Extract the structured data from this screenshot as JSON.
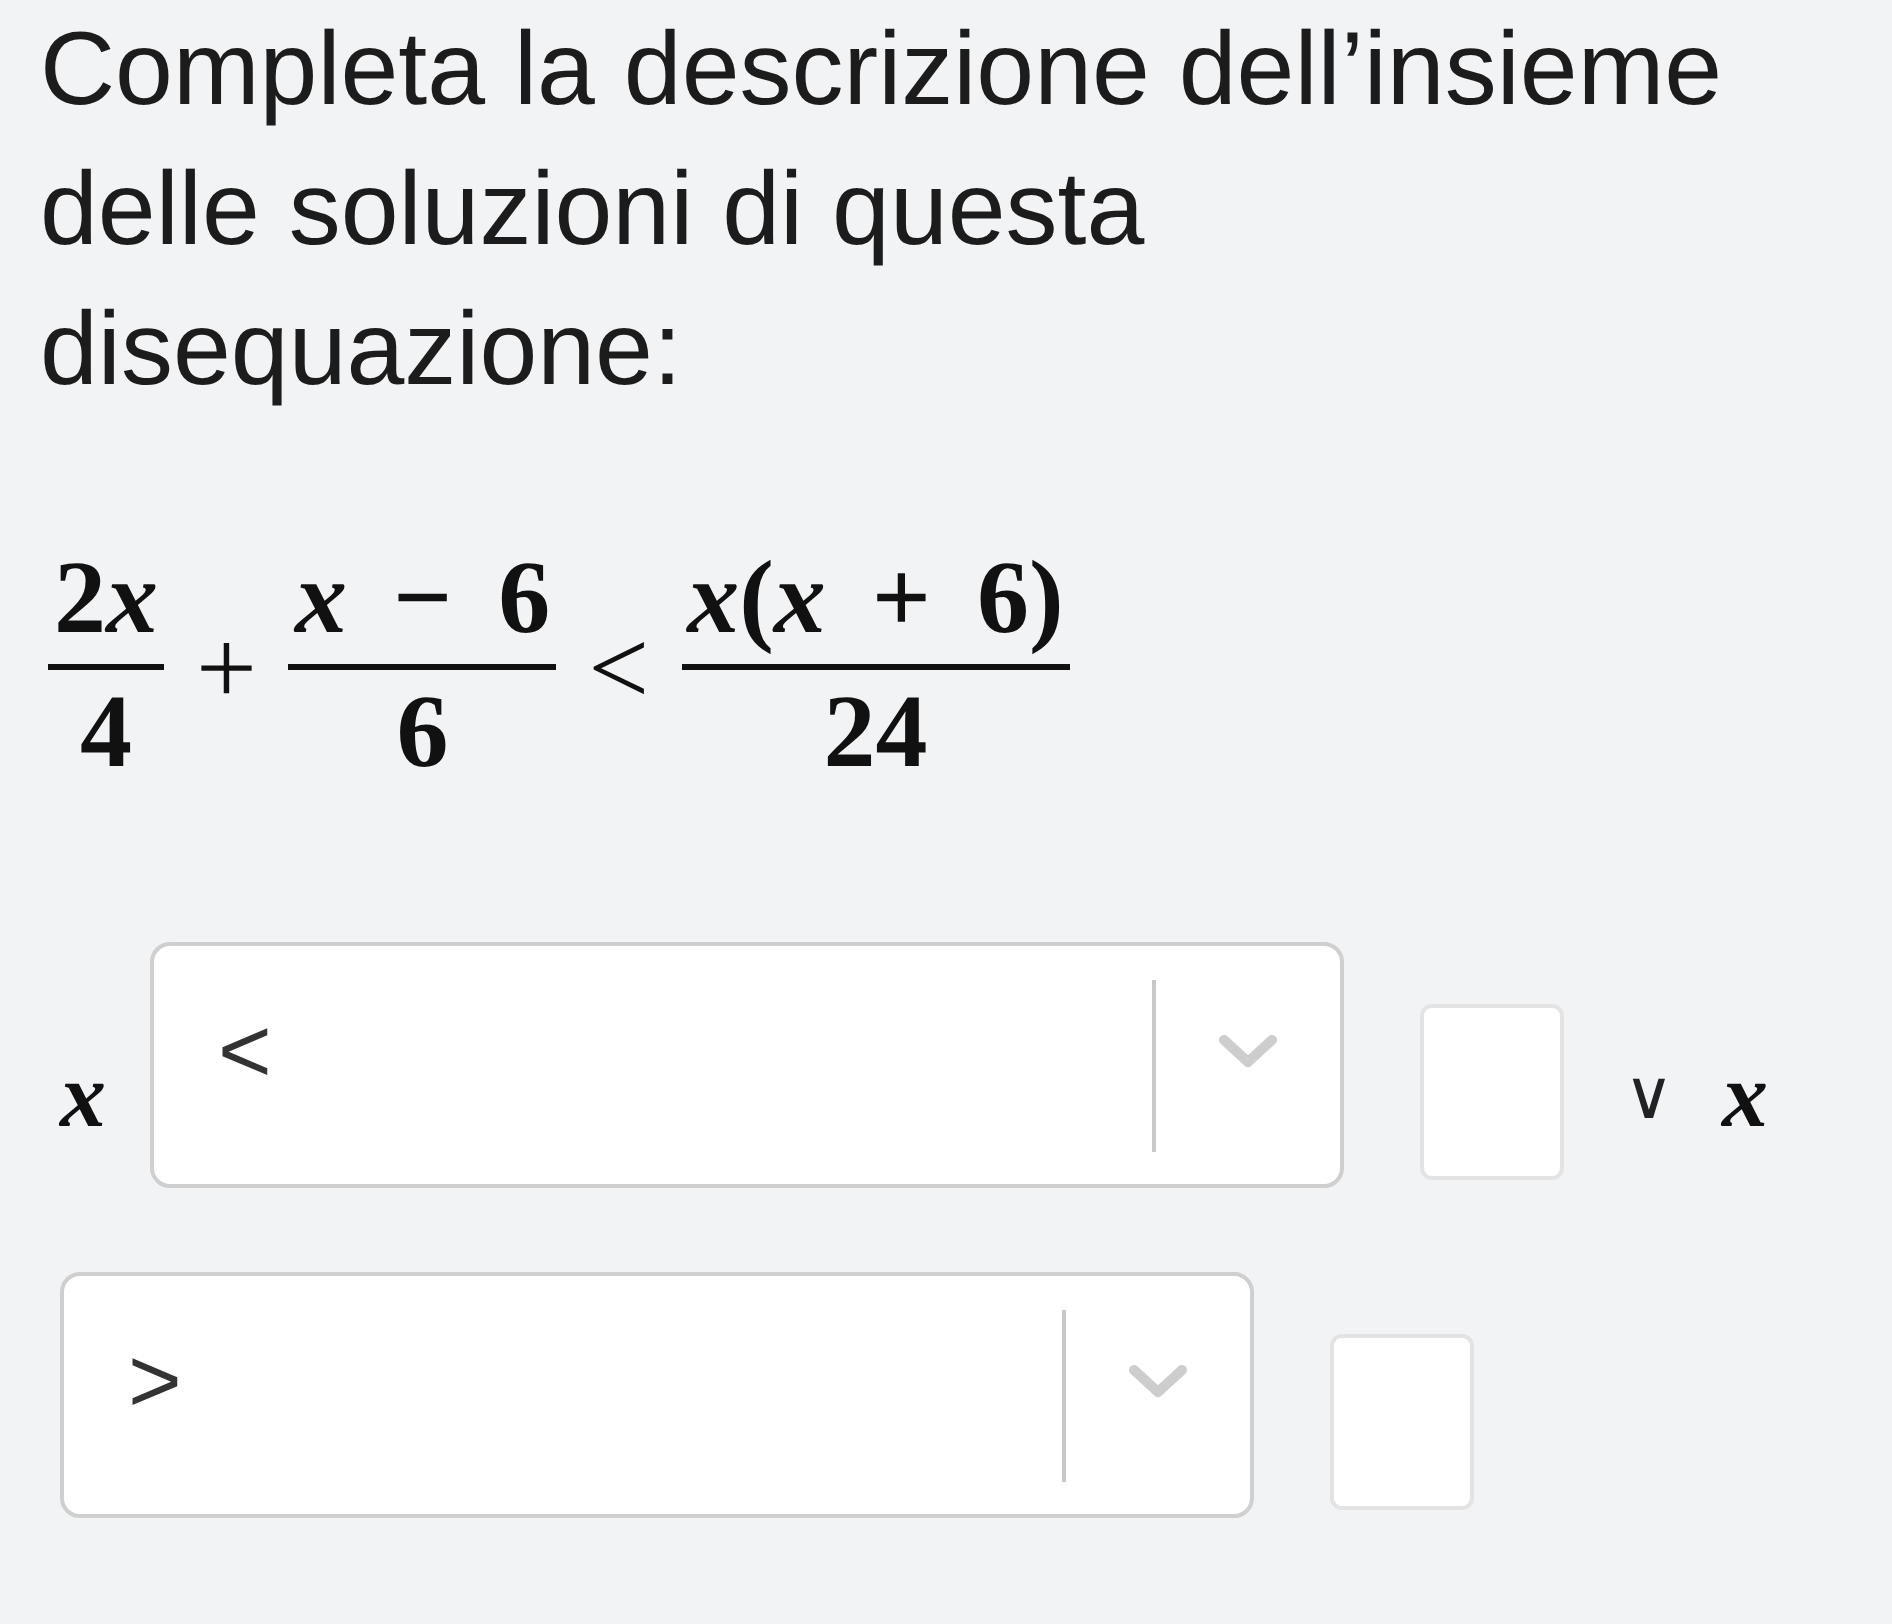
{
  "prompt": "Completa la descrizione dell’insieme delle soluzioni di questa disequazione:",
  "inequality": [
    {
      "kind": "fraction",
      "numerator": [
        "2",
        "*x*"
      ],
      "denominator": "4"
    },
    {
      "kind": "operator",
      "text": "+"
    },
    {
      "kind": "fraction",
      "numerator": [
        "*x* − 6"
      ],
      "denominator": "6"
    },
    {
      "kind": "operator",
      "text": "<"
    },
    {
      "kind": "fraction",
      "numerator": [
        "*x*(*x* + 6)"
      ],
      "denominator": "24"
    }
  ],
  "answer": [
    {
      "kind": "variable",
      "text": "x"
    },
    {
      "kind": "dropdown",
      "value": "<"
    },
    {
      "kind": "answer_box"
    },
    {
      "kind": "connector",
      "text": "∨"
    },
    {
      "kind": "variable",
      "text": "x"
    },
    {
      "kind": "dropdown",
      "value": ">"
    },
    {
      "kind": "answer_box"
    }
  ]
}
